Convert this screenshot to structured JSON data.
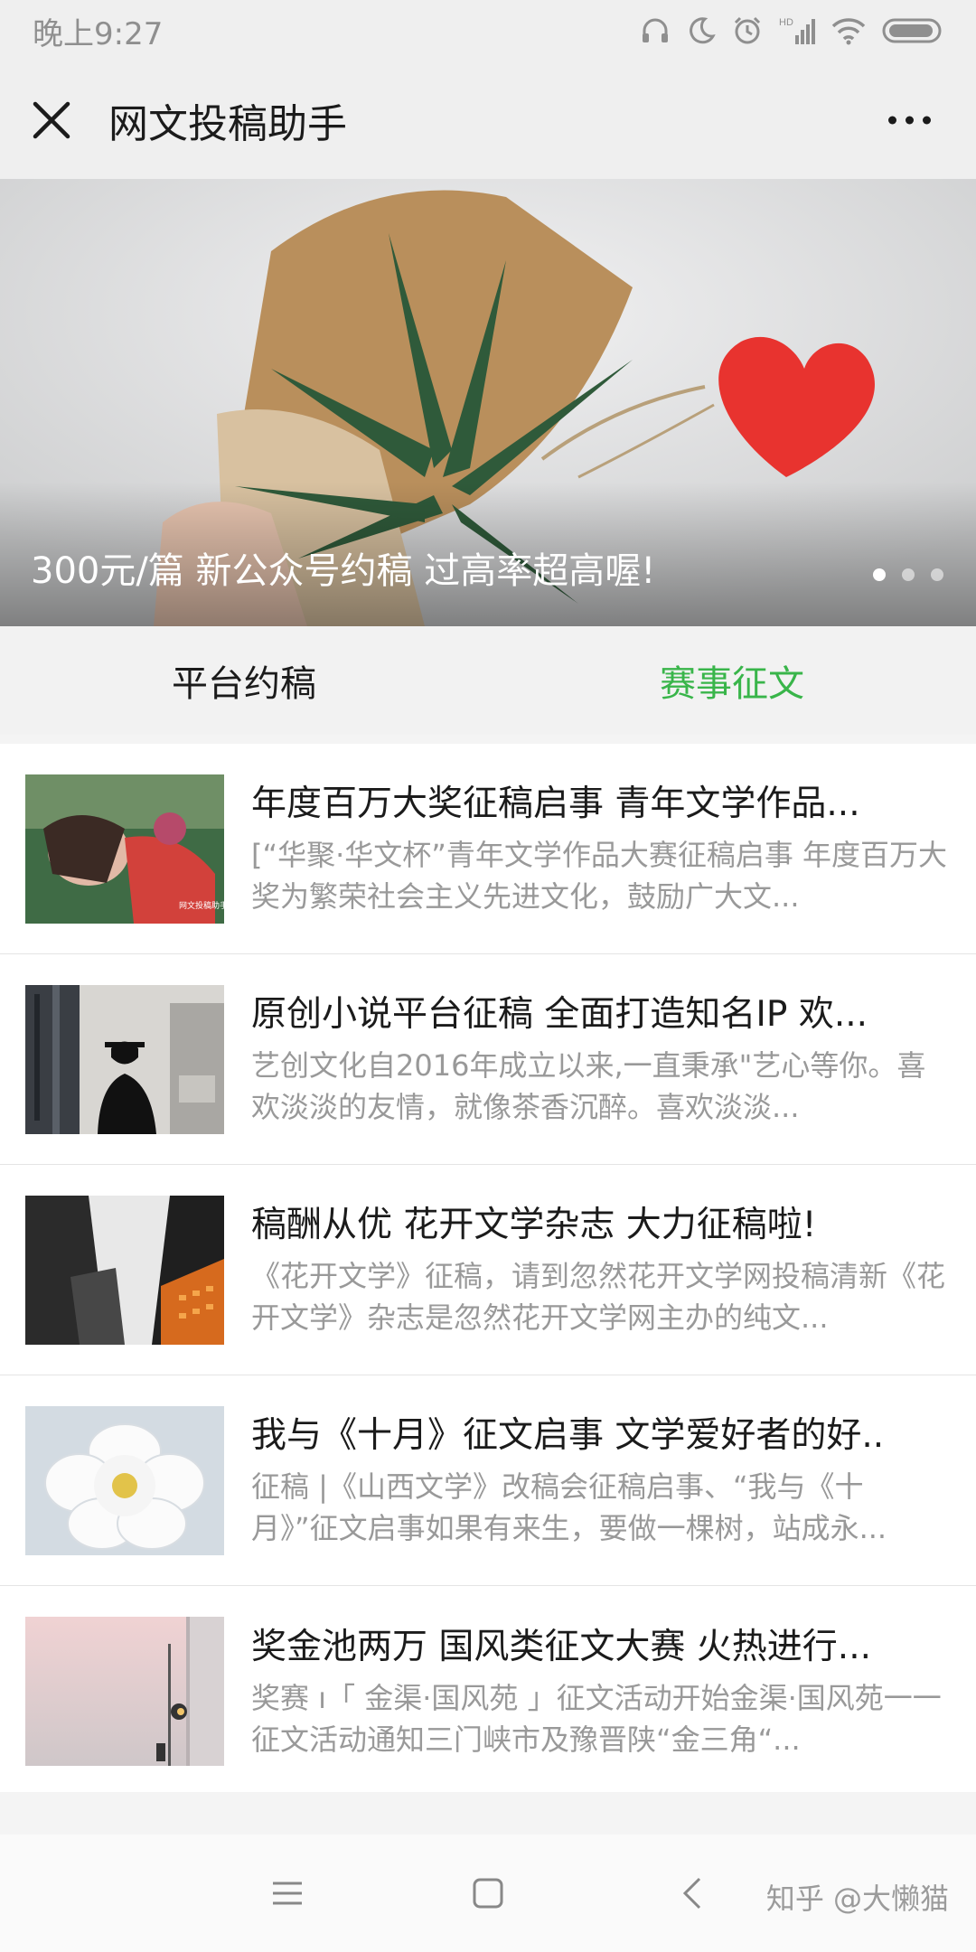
{
  "status_bar": {
    "time": "晚上9:27",
    "icons": [
      "headphones-icon",
      "moon-icon",
      "alarm-icon",
      "signal-icon",
      "wifi-icon",
      "battery-icon"
    ],
    "network": "HD"
  },
  "header": {
    "title": "网文投稿助手",
    "close_icon": "close-icon",
    "more_icon": "more-icon"
  },
  "banner": {
    "caption": "300元/篇 新公众号约稿 过高率超高喔!",
    "slide_count": 3,
    "active_slide": 0
  },
  "tabs": [
    {
      "label": "平台约稿",
      "active": false
    },
    {
      "label": "赛事征文",
      "active": true
    }
  ],
  "articles": [
    {
      "title": "年度百万大奖征稿启事 青年文学作品...",
      "desc": "[“华聚·华文杯”青年文学作品大赛征稿启事 年度百万大奖为繁荣社会主义先进文化，鼓励广大文...",
      "thumb": "woman-photo"
    },
    {
      "title": "原创小说平台征稿 全面打造知名IP 欢...",
      "desc": "艺创文化自2016年成立以来,一直秉承\"艺心等你。喜欢淡淡的友情，就像茶香沉醉。喜欢淡淡...",
      "thumb": "city-silhouette-photo"
    },
    {
      "title": "稿酬从优 花开文学杂志 大力征稿啦!",
      "desc": "《花开文学》征稿，请到忽然花开文学网投稿清新《花开文学》杂志是忽然花开文学网主办的纯文...",
      "thumb": "skyscraper-photo"
    },
    {
      "title": "我与《十月》征文启事 文学爱好者的好..",
      "desc": "征稿 |《山西文学》改稿会征稿启事、“我与《十月》”征文启事如果有来生，要做一棵树，站成永...",
      "thumb": "white-flower-photo"
    },
    {
      "title": "奖金池两万 国风类征文大赛 火热进行...",
      "desc": "奖赛 ı「 金渠·国风苑 」征文活动开始金渠·国风苑一一征文活动通知三门峡市及豫晋陕“金三角“...",
      "thumb": "pink-wall-photo"
    }
  ],
  "nav_bar": {
    "icons": [
      "menu-icon",
      "home-icon",
      "back-icon"
    ]
  },
  "watermark": "知乎 @大懒猫",
  "colors": {
    "accent": "#39b54a",
    "background": "#f4f4f4",
    "bar": "#efefef",
    "desc_text": "#999999"
  }
}
